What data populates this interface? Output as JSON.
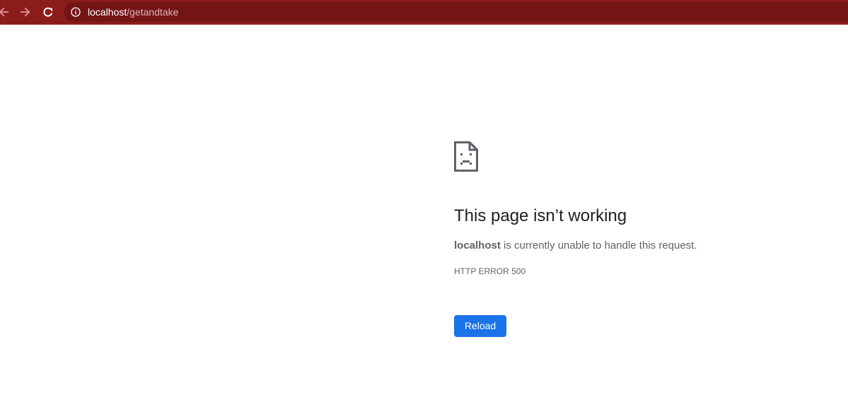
{
  "browser": {
    "url_host": "localhost",
    "url_path": "/getandtake",
    "icons": {
      "back": "arrow-left-icon",
      "forward": "arrow-right-icon",
      "reload": "reload-icon",
      "info": "info-icon"
    },
    "colors": {
      "toolbar": "#8b1c1c",
      "omnibox": "#731515"
    }
  },
  "error": {
    "icon": "sad-page-icon",
    "title": "This page isn’t working",
    "host": "localhost",
    "message": " is currently unable to handle this request.",
    "code": "HTTP ERROR 500",
    "reload_label": "Reload",
    "colors": {
      "button": "#1a73e8",
      "title": "#202124",
      "text": "#5f6368"
    }
  }
}
